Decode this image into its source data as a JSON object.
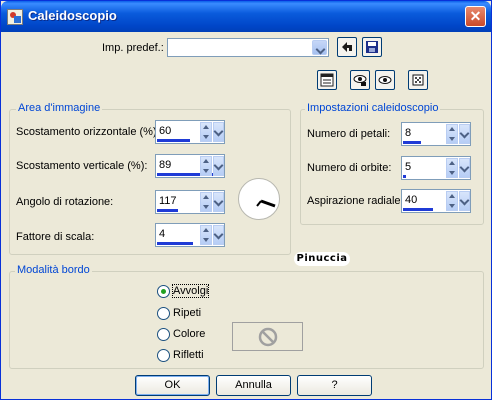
{
  "window": {
    "title": "Caleidoscopio",
    "close_glyph": "✕"
  },
  "preset": {
    "label": "Imp. predef.:",
    "value": ""
  },
  "toolbar_icons": [
    "save-as-icon",
    "save-icon"
  ],
  "view_icons": [
    "preview-window-icon",
    "eye-lock-icon",
    "eye-icon",
    "randomize-dice-icon"
  ],
  "area": {
    "title": "Area d'immagine",
    "rows": [
      {
        "label": "Scostamento orizzontale (%):",
        "value": "60",
        "fill": 0.5
      },
      {
        "label": "Scostamento verticale (%):",
        "value": "89",
        "fill": 0.95
      },
      {
        "label": "Angolo di rotazione:",
        "value": "117",
        "fill": 0.32
      },
      {
        "label": "Fattore di scala:",
        "value": "4",
        "fill": 0.55
      }
    ]
  },
  "kaleido": {
    "title": "Impostazioni caleidoscopio",
    "rows": [
      {
        "label": "Numero di petali:",
        "value": "8",
        "fill": 0.28
      },
      {
        "label": "Numero di orbite:",
        "value": "5",
        "fill": 0.05
      },
      {
        "label": "Aspirazione radiale:",
        "value": "40",
        "fill": 0.45
      }
    ]
  },
  "watermark": "Pinuccia",
  "border_mode": {
    "title": "Modalità bordo",
    "options": [
      "Avvolgi",
      "Ripeti",
      "Colore",
      "Rifletti"
    ],
    "selected": "Avvolgi"
  },
  "buttons": {
    "ok": "OK",
    "cancel": "Annulla",
    "help": "?"
  },
  "colors": {
    "title_bar": "#0054e3",
    "group_title": "#0046d5",
    "spin_bar": "#1f3bd6",
    "radio_dot": "#21a121"
  }
}
